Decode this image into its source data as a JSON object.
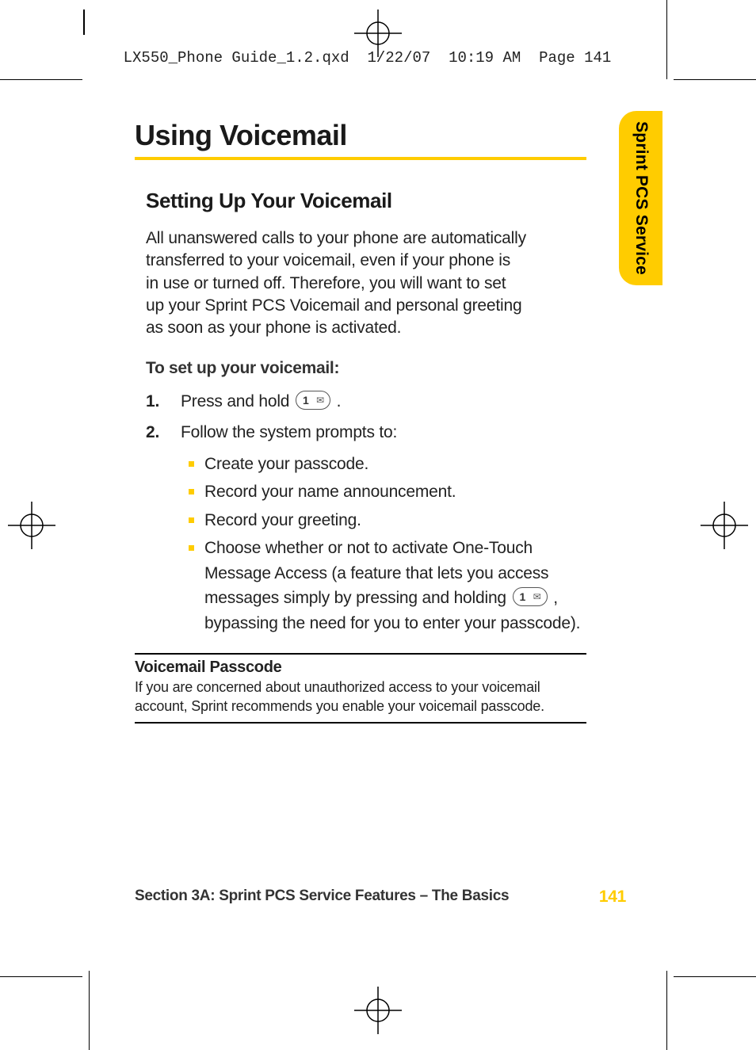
{
  "print_header": "LX550_Phone Guide_1.2.qxd  1/22/07  10:19 AM  Page 141",
  "side_tab": "Sprint PCS Service",
  "title": "Using Voicemail",
  "subtitle": "Setting Up Your Voicemail",
  "intro": "All unanswered calls to your phone are automatically transferred to your voicemail, even if your phone is in use or turned off. Therefore, you will want to set up your Sprint PCS Voicemail and personal greeting as soon as your phone is activated.",
  "lead": "To set up your voicemail:",
  "steps": {
    "s1_pre": "Press and hold ",
    "s1_post": " .",
    "s2_intro": "Follow the system prompts to:",
    "bullets": {
      "b1": "Create your passcode.",
      "b2": "Record your name announcement.",
      "b3": "Record your greeting.",
      "b4_pre": "Choose whether or not to activate One-Touch Message Access (a feature that lets you access messages simply by pressing and holding ",
      "b4_post": " , bypassing the need for you to enter your passcode)."
    }
  },
  "note": {
    "title": "Voicemail Passcode",
    "body": "If you are concerned about unauthorized access to your voicemail account, Sprint recommends you enable your voicemail passcode."
  },
  "footer": {
    "section": "Section 3A: Sprint PCS Service Features – The Basics",
    "page": "141"
  }
}
